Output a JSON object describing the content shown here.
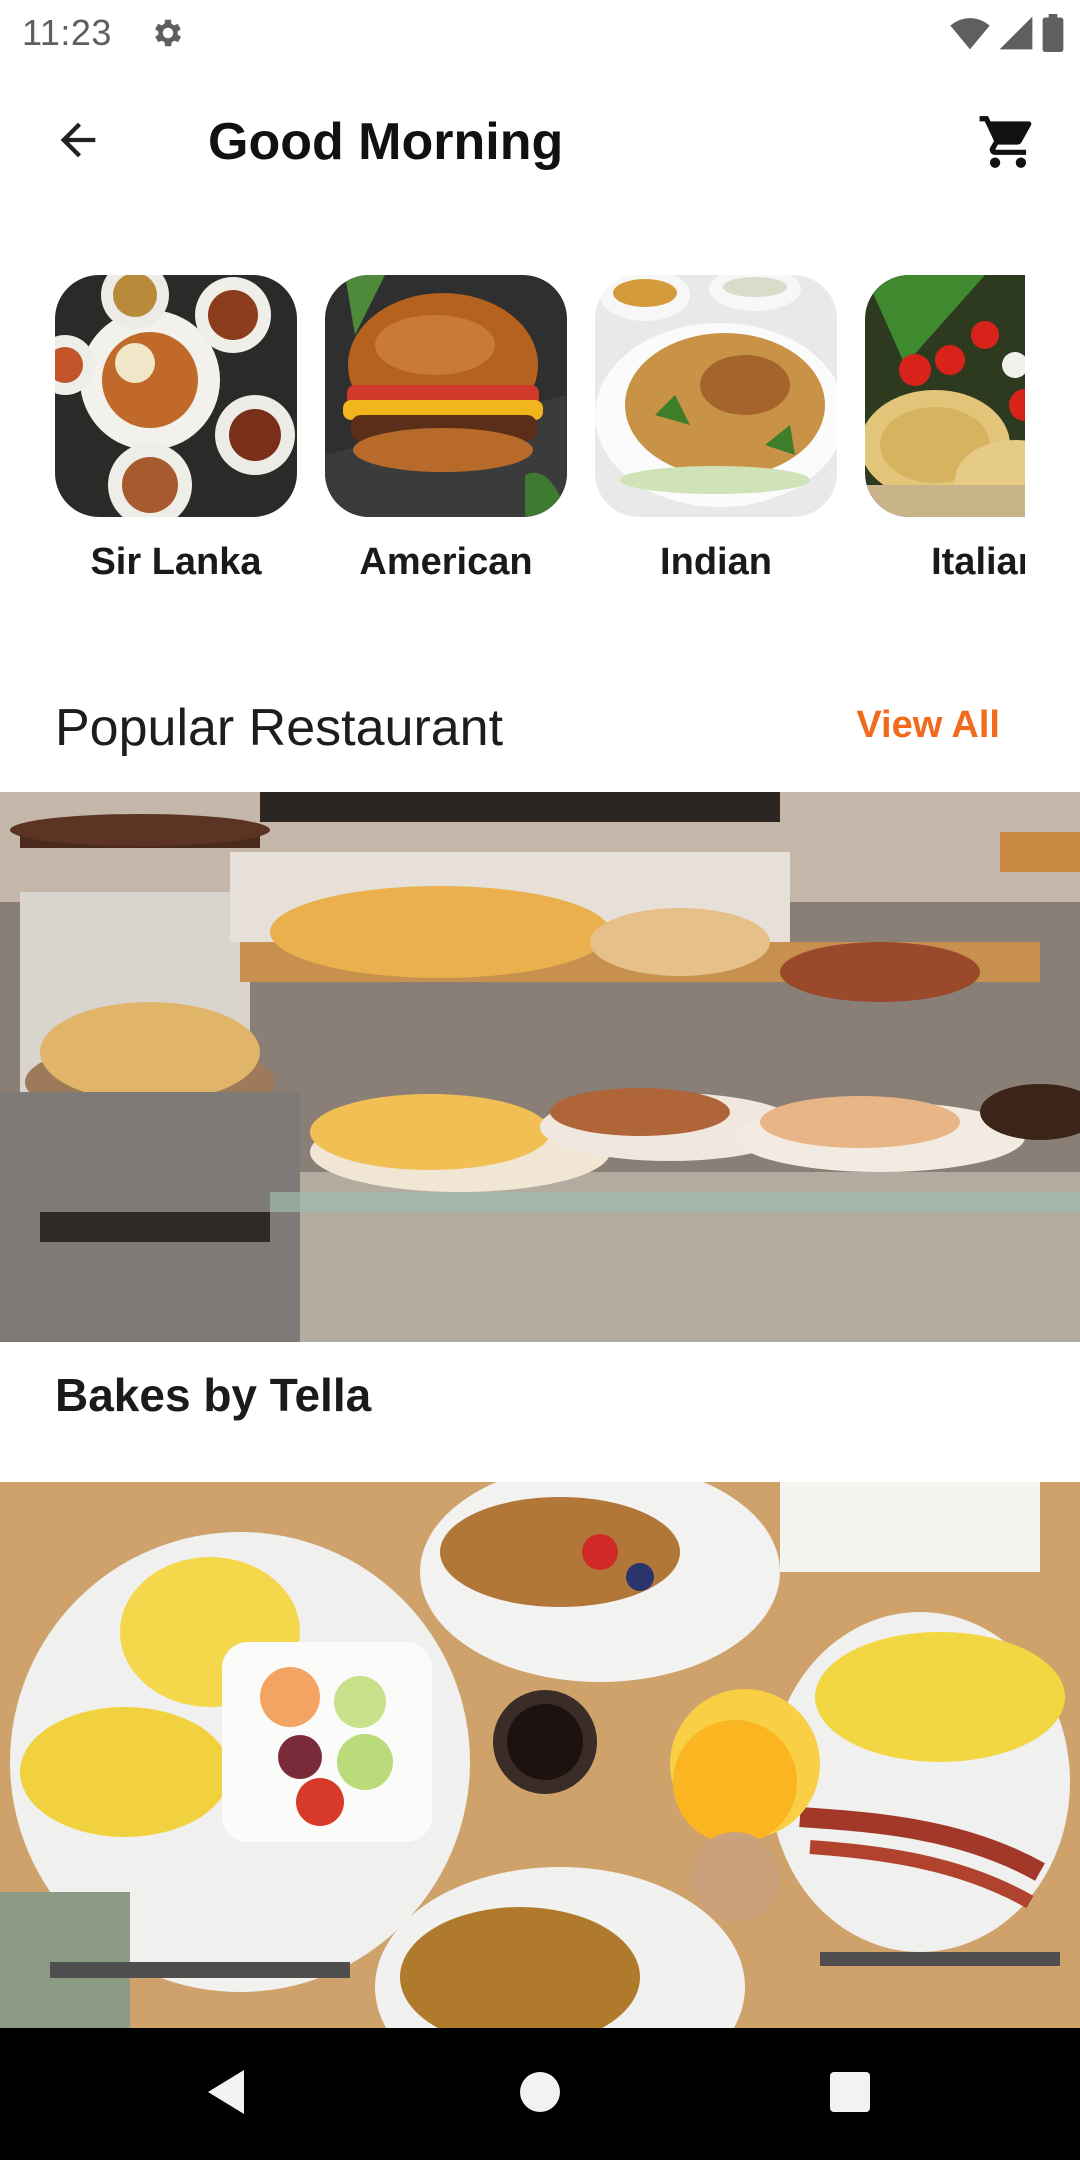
{
  "status_bar": {
    "time": "11:23",
    "icons": [
      "gear-icon",
      "wifi-icon",
      "signal-icon",
      "battery-icon"
    ]
  },
  "header": {
    "title": "Good Morning",
    "back_icon": "arrow-left-icon",
    "cart_icon": "shopping-cart-icon"
  },
  "categories": [
    {
      "label": "Sir Lanka"
    },
    {
      "label": "American"
    },
    {
      "label": "Indian"
    },
    {
      "label": "Italian"
    }
  ],
  "popular": {
    "title": "Popular Restaurant",
    "view_all_label": "View All"
  },
  "restaurants": [
    {
      "name": "Bakes by Tella"
    },
    {
      "name": ""
    }
  ],
  "colors": {
    "accent": "#f26a1b",
    "nav_bar": "#000000"
  },
  "nav": {
    "icons": [
      "back-triangle-icon",
      "home-circle-icon",
      "recents-square-icon"
    ]
  }
}
